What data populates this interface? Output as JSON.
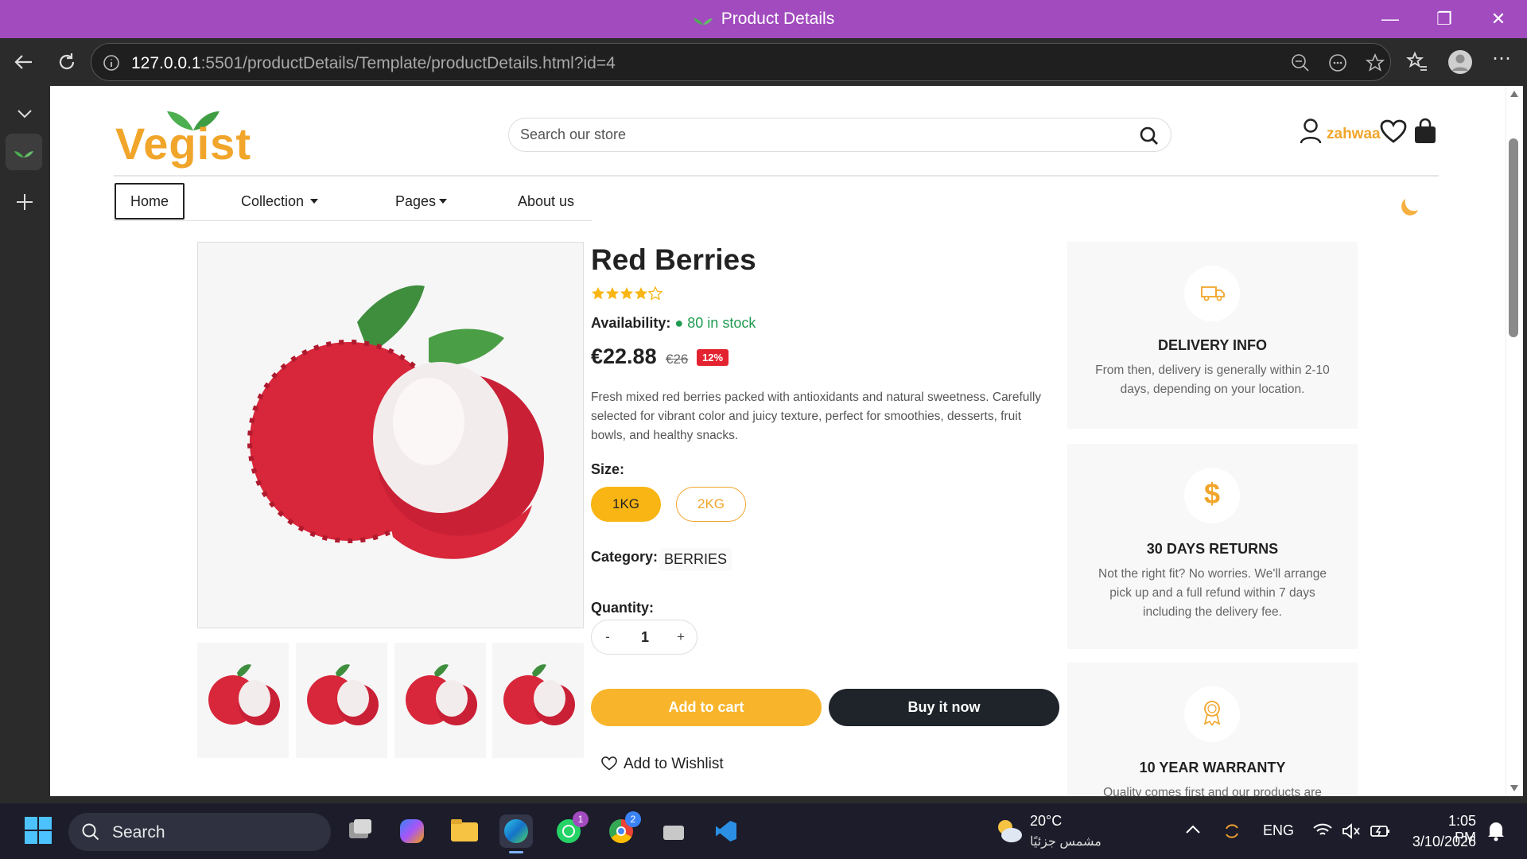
{
  "window": {
    "title": "Product Details"
  },
  "browser": {
    "url_host": "127.0.0.1",
    "url_rest": ":5501/productDetails/Template/productDetails.html?id=4"
  },
  "header": {
    "logo_text": "Vegist",
    "search_placeholder": "Search our store",
    "username": "zahwaa"
  },
  "nav": {
    "home": "Home",
    "collection": "Collection",
    "pages": "Pages",
    "about": "About us"
  },
  "product": {
    "name": "Red Berries",
    "rating": 4,
    "rating_max": 5,
    "availability_label": "Availability:",
    "availability_value": "80 in stock",
    "price": "€22.88",
    "old_price": "€26",
    "discount": "12%",
    "description": "Fresh mixed red berries packed with antioxidants and natural sweetness. Carefully selected for vibrant color and juicy texture, perfect for smoothies, desserts, fruit bowls, and healthy snacks.",
    "size_label": "Size:",
    "sizes": [
      "1KG",
      "2KG"
    ],
    "selected_size": "1KG",
    "category_label": "Category:",
    "category": "BERRIES",
    "quantity_label": "Quantity:",
    "quantity_minus": "-",
    "quantity": "1",
    "quantity_plus": "+",
    "add_to_cart": "Add to cart",
    "buy_now": "Buy it now",
    "wishlist": "Add to Wishlist"
  },
  "cards": [
    {
      "title": "DELIVERY INFO",
      "text": "From then, delivery is generally within 2-10 days, depending on your location.",
      "icon": "truck-icon"
    },
    {
      "title": "30 DAYS RETURNS",
      "text": "Not the right fit? No worries. We'll arrange pick up and a full refund within 7 days including the delivery fee.",
      "icon": "dollar-icon"
    },
    {
      "title": "10 YEAR WARRANTY",
      "text": "Quality comes first and our products are",
      "icon": "award-icon"
    }
  ],
  "taskbar": {
    "search": "Search",
    "weather_temp": "20°C",
    "weather_desc": "مشمس جزئيًا",
    "lang": "ENG",
    "time": "1:05 PM",
    "date": "3/10/2026",
    "whatsapp_badge": "1",
    "chrome_badge": "2"
  },
  "colors": {
    "accent": "#f8b514",
    "brand_purple": "#a24bbf",
    "in_stock": "#1f9b50",
    "discount": "#e32330"
  }
}
